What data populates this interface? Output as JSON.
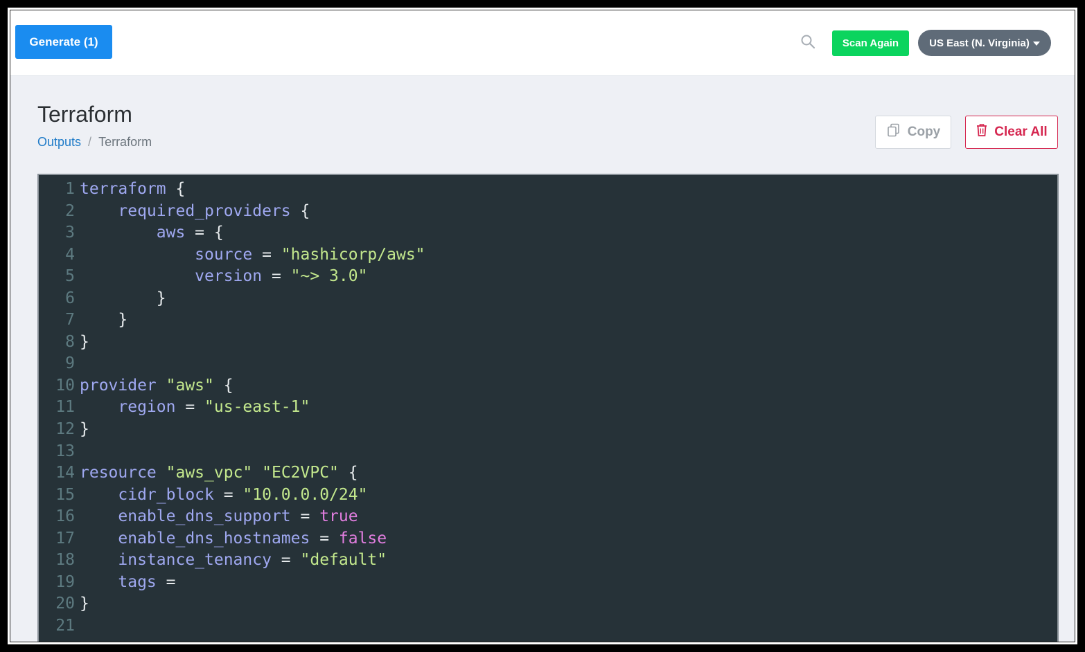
{
  "toolbar": {
    "generate_label": "Generate (1)",
    "scan_label": "Scan Again",
    "region_label": "US East (N. Virginia)",
    "search_icon": "search-icon"
  },
  "header": {
    "title": "Terraform",
    "breadcrumb": [
      {
        "label": "Outputs",
        "link": true
      },
      {
        "label": "Terraform",
        "link": false
      }
    ],
    "copy_label": "Copy",
    "clear_label": "Clear All"
  },
  "colors": {
    "primary": "#1a8cf0",
    "success": "#0bd45e",
    "region_bg": "#5f6b78",
    "danger": "#d5264f",
    "code_bg": "#263238"
  },
  "code": {
    "lines": [
      [
        {
          "t": "kw",
          "v": "terraform"
        },
        {
          "t": "punc",
          "v": " {"
        }
      ],
      [
        {
          "t": "punc",
          "v": "    "
        },
        {
          "t": "kw",
          "v": "required_providers"
        },
        {
          "t": "punc",
          "v": " {"
        }
      ],
      [
        {
          "t": "punc",
          "v": "        "
        },
        {
          "t": "kw",
          "v": "aws"
        },
        {
          "t": "punc",
          "v": " = {"
        }
      ],
      [
        {
          "t": "punc",
          "v": "            "
        },
        {
          "t": "kw",
          "v": "source"
        },
        {
          "t": "punc",
          "v": " = "
        },
        {
          "t": "str",
          "v": "\"hashicorp/aws\""
        }
      ],
      [
        {
          "t": "punc",
          "v": "            "
        },
        {
          "t": "kw",
          "v": "version"
        },
        {
          "t": "punc",
          "v": " = "
        },
        {
          "t": "str",
          "v": "\"~> 3.0\""
        }
      ],
      [
        {
          "t": "punc",
          "v": "        }"
        }
      ],
      [
        {
          "t": "punc",
          "v": "    }"
        }
      ],
      [
        {
          "t": "punc",
          "v": "}"
        }
      ],
      [],
      [
        {
          "t": "kw",
          "v": "provider"
        },
        {
          "t": "punc",
          "v": " "
        },
        {
          "t": "str",
          "v": "\"aws\""
        },
        {
          "t": "punc",
          "v": " {"
        }
      ],
      [
        {
          "t": "punc",
          "v": "    "
        },
        {
          "t": "kw",
          "v": "region"
        },
        {
          "t": "punc",
          "v": " = "
        },
        {
          "t": "str",
          "v": "\"us-east-1\""
        }
      ],
      [
        {
          "t": "punc",
          "v": "}"
        }
      ],
      [],
      [
        {
          "t": "kw",
          "v": "resource"
        },
        {
          "t": "punc",
          "v": " "
        },
        {
          "t": "str",
          "v": "\"aws_vpc\""
        },
        {
          "t": "punc",
          "v": " "
        },
        {
          "t": "str",
          "v": "\"EC2VPC\""
        },
        {
          "t": "punc",
          "v": " {"
        }
      ],
      [
        {
          "t": "punc",
          "v": "    "
        },
        {
          "t": "kw",
          "v": "cidr_block"
        },
        {
          "t": "punc",
          "v": " = "
        },
        {
          "t": "str",
          "v": "\"10.0.0.0/24\""
        }
      ],
      [
        {
          "t": "punc",
          "v": "    "
        },
        {
          "t": "kw",
          "v": "enable_dns_support"
        },
        {
          "t": "punc",
          "v": " = "
        },
        {
          "t": "bool",
          "v": "true"
        }
      ],
      [
        {
          "t": "punc",
          "v": "    "
        },
        {
          "t": "kw",
          "v": "enable_dns_hostnames"
        },
        {
          "t": "punc",
          "v": " = "
        },
        {
          "t": "bool",
          "v": "false"
        }
      ],
      [
        {
          "t": "punc",
          "v": "    "
        },
        {
          "t": "kw",
          "v": "instance_tenancy"
        },
        {
          "t": "punc",
          "v": " = "
        },
        {
          "t": "str",
          "v": "\"default\""
        }
      ],
      [
        {
          "t": "punc",
          "v": "    "
        },
        {
          "t": "kw",
          "v": "tags"
        },
        {
          "t": "punc",
          "v": " ="
        }
      ],
      [
        {
          "t": "punc",
          "v": "}"
        }
      ],
      []
    ]
  }
}
